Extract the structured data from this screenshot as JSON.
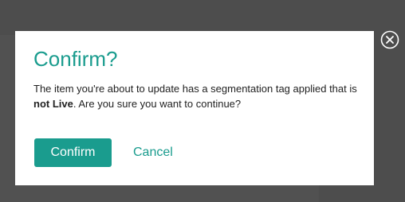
{
  "dialog": {
    "title": "Confirm?",
    "message_before": "The item you're about to update has a segmentation tag applied that is ",
    "message_emphasis": "not Live",
    "message_after": ". Are you sure you want to continue?",
    "confirm_label": "Confirm",
    "cancel_label": "Cancel",
    "close_icon": "close-circle-icon"
  },
  "colors": {
    "accent": "#1a9c8e",
    "overlay": "#4d4d4d",
    "dialog_background": "#ffffff",
    "text": "#222222"
  }
}
